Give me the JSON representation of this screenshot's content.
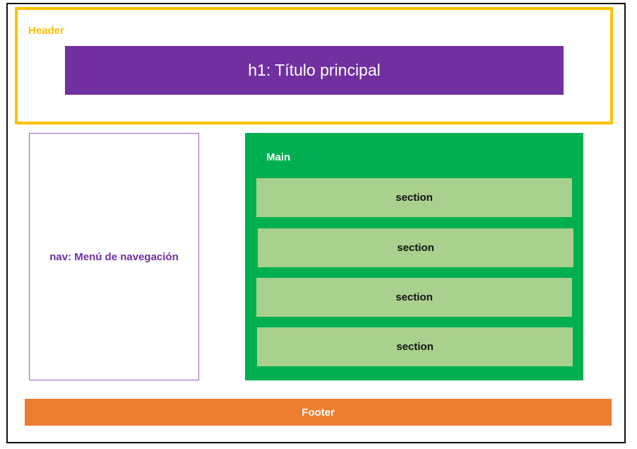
{
  "header": {
    "label": "Header",
    "h1_text": "h1: Título principal"
  },
  "nav": {
    "label": "nav: Menú de navegación"
  },
  "main": {
    "label": "Main",
    "sections": [
      {
        "label": "section"
      },
      {
        "label": "section"
      },
      {
        "label": "section"
      },
      {
        "label": "section"
      }
    ]
  },
  "footer": {
    "label": "Footer"
  },
  "colors": {
    "header_border": "#ffc000",
    "h1_fill": "#7030a0",
    "nav_border": "#9b5fc0",
    "nav_text": "#7030a0",
    "main_fill": "#00b050",
    "section_fill": "#a9d18e",
    "footer_fill": "#ed7d31"
  }
}
